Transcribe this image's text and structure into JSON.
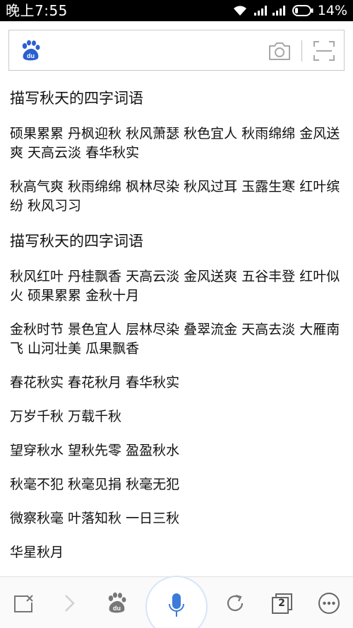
{
  "status_bar": {
    "time": "晚上7:55",
    "battery_percent": "14%",
    "icons": [
      "wifi-icon",
      "signal-icon",
      "signal-icon",
      "battery-icon"
    ]
  },
  "search": {
    "logo": "baidu-paw-logo",
    "value": "",
    "icons": [
      "camera-icon",
      "scan-icon"
    ]
  },
  "content": {
    "section1": {
      "title": "描写秋天的四字词语",
      "paragraphs": [
        "硕果累累 丹枫迎秋 秋风萧瑟 秋色宜人 秋雨绵绵 金风送爽 天高云淡 春华秋实",
        "秋高气爽 秋雨绵绵 枫林尽染 秋风过耳 玉露生寒 红叶缤纷 秋风习习"
      ]
    },
    "section2": {
      "title": "描写秋天的四字词语",
      "paragraphs": [
        "秋风红叶 丹桂飘香 天高云淡 金风送爽 五谷丰登 红叶似火 硕果累累 金秋十月",
        "金秋时节 景色宜人 层林尽染 叠翠流金 天高去淡 大雁南飞 山河壮美 瓜果飘香",
        "春花秋实 春花秋月 春华秋实",
        "万岁千秋 万载千秋",
        "望穿秋水 望秋先零 盈盈秋水",
        "秋毫不犯 秋毫见捐 秋毫无犯",
        "微察秋毫 叶落知秋 一日三秋",
        "华星秋月"
      ]
    }
  },
  "toolbar": {
    "tab_count": "2",
    "icons": [
      "close-window-icon",
      "forward-icon",
      "baidu-paw-icon",
      "microphone-icon",
      "refresh-icon",
      "tabs-icon",
      "more-icon"
    ]
  },
  "colors": {
    "baidu_blue": "#2c5fd0",
    "mic_blue": "#3c7bd8",
    "icon_gray": "#9a9a9a",
    "status_bg": "#000000"
  }
}
